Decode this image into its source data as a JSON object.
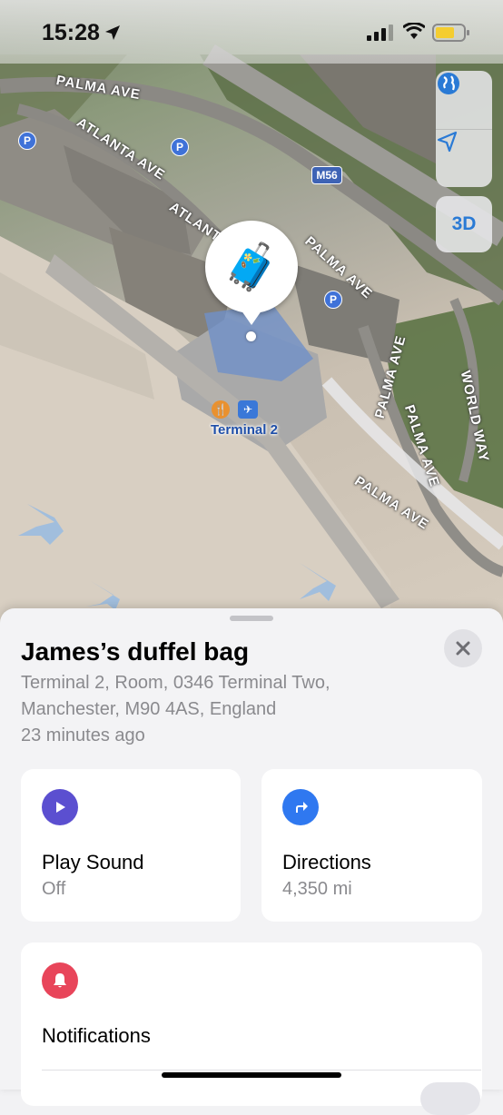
{
  "status_bar": {
    "time": "15:28"
  },
  "map": {
    "roads": [
      "PALMA AVE",
      "ATLANTA AVE",
      "ATLANTA",
      "PALMA AVE",
      "PALMA AVE",
      "PALMA AVE",
      "PALMA AVE",
      "WORLD WAY"
    ],
    "motorway_badge": "M56",
    "parking_badge": "P",
    "terminal_label": "Terminal 2",
    "pin_emoji": "🧳",
    "button_3d": "3D"
  },
  "item": {
    "name": "James’s duffel bag",
    "address_line1": "Terminal 2, Room, 0346 Terminal Two,",
    "address_line2": "Manchester, M90 4AS, England",
    "last_seen": "23 minutes ago"
  },
  "actions": {
    "play_sound": {
      "label": "Play Sound",
      "sub": "Off",
      "color": "#5b4fd0"
    },
    "directions": {
      "label": "Directions",
      "sub": "4,350 mi",
      "color": "#2f78f0"
    }
  },
  "notifications": {
    "label": "Notifications",
    "color": "#e8455a"
  },
  "colors": {
    "accent_blue": "#2a7ad5",
    "sheet_bg": "#f3f3f5"
  }
}
